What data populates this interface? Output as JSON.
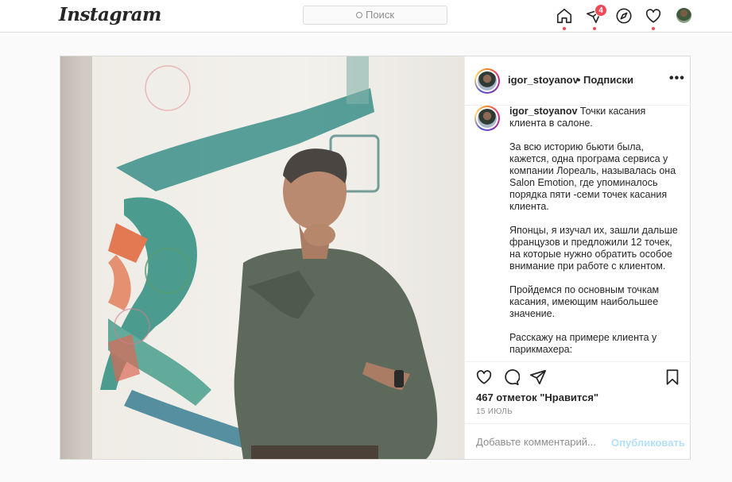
{
  "header": {
    "logo": "Instagram",
    "search_placeholder": "Поиск",
    "direct_badge": "4"
  },
  "post": {
    "username": "igor_stoyanov",
    "separator": "•",
    "follow_label": "Подписки",
    "more_label": "•••",
    "caption_username": "igor_stoyanov",
    "caption_first": "Точки касания клиента в салоне.",
    "caption_paragraphs": [
      "За всю историю бьюти была, кажется, одна програма сервиса у компании Лореаль, называлась она Salon Emotion, где упоминалось порядка пяти -семи точек касания клиента.",
      "Японцы, я изучал их, зашли дальше французов и предложили 12 точек, на которые нужно обратить особое внимание при работе с клиентом.",
      "Пройдемся по основным точкам касания, имеющим наибольшее значение.",
      "Расскажу на примере клиента у парикмахера:"
    ],
    "likes": "467 отметок \"Нравится\"",
    "date": "15 ИЮЛЬ",
    "comment_placeholder": "Добавьте комментарий...",
    "publish_label": "Опубликовать"
  },
  "icons": {
    "home": "home-icon",
    "direct": "direct-icon",
    "explore": "compass-icon",
    "activity": "heart-icon",
    "like": "heart-icon",
    "comment": "comment-icon",
    "share": "share-icon",
    "save": "bookmark-icon"
  },
  "colors": {
    "accent_red": "#ed4956",
    "link_disabled": "#b2dffc",
    "text_primary": "#262626",
    "text_secondary": "#8e8e8e"
  }
}
